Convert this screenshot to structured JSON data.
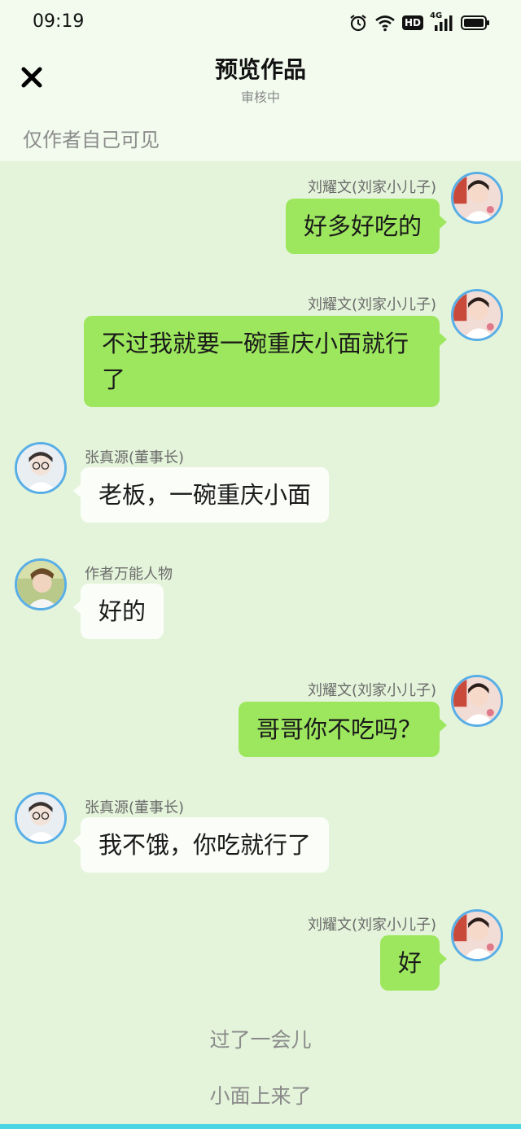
{
  "status_bar": {
    "time": "09:19",
    "icons": [
      "alarm-icon",
      "wifi-icon",
      "hd-icon",
      "signal-4g-icon",
      "battery-icon"
    ],
    "hd_label": "HD",
    "network_label": "4G"
  },
  "header": {
    "title": "预览作品",
    "subtitle": "审核中",
    "visibility_note": "仅作者自己可见",
    "close_icon": "close-icon"
  },
  "messages": [
    {
      "side": "right",
      "sender": "刘耀文(刘家小儿子)",
      "text": "好多好吃的"
    },
    {
      "side": "right",
      "sender": "刘耀文(刘家小儿子)",
      "text": "不过我就要一碗重庆小面就行了"
    },
    {
      "side": "left",
      "sender": "张真源(董事长)",
      "text": "老板，一碗重庆小面"
    },
    {
      "side": "left",
      "sender": "作者万能人物",
      "text": "好的"
    },
    {
      "side": "right",
      "sender": "刘耀文(刘家小儿子)",
      "text": "哥哥你不吃吗？"
    },
    {
      "side": "left",
      "sender": "张真源(董事长)",
      "text": "我不饿，你吃就行了"
    },
    {
      "side": "right",
      "sender": "刘耀文(刘家小儿子)",
      "text": "好"
    }
  ],
  "narrations": [
    "过了一会儿",
    "小面上来了"
  ],
  "colors": {
    "background": "#E4F4DA",
    "header_background": "#F3FBEE",
    "right_bubble": "#9DE75E",
    "left_bubble": "#FBFDF9",
    "avatar_ring": "#59AEE6",
    "bottom_accent": "#48D6E4"
  }
}
